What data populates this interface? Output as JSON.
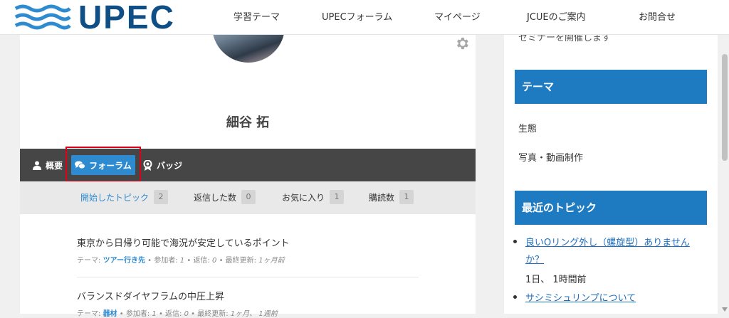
{
  "header": {
    "logo_text": "UPEC",
    "nav": [
      {
        "label": "学習テーマ"
      },
      {
        "label": "UPECフォーラム"
      },
      {
        "label": "マイページ"
      },
      {
        "label": "JCUEのご案内"
      },
      {
        "label": "お問合せ"
      }
    ]
  },
  "profile": {
    "name": "細谷 拓"
  },
  "tabs": {
    "overview": "概要",
    "forum": "フォーラム",
    "badges": "バッジ"
  },
  "subnav": [
    {
      "label": "開始したトピック",
      "count": "2"
    },
    {
      "label": "返信した数",
      "count": "0"
    },
    {
      "label": "お気に入り",
      "count": "1"
    },
    {
      "label": "購読数",
      "count": "1"
    }
  ],
  "topics": [
    {
      "title": "東京から日帰り可能で海況が安定しているポイント",
      "theme_label": "テーマ: ",
      "theme": "ツアー行き先",
      "participants_label": "参加者: ",
      "participants": "1",
      "replies_label": "返信: ",
      "replies": "0",
      "updated_label": "最終更新: ",
      "updated": "1ヶ月前"
    },
    {
      "title": "バランスドダイヤフラムの中圧上昇",
      "theme_label": "テーマ: ",
      "theme": "器材",
      "participants_label": "参加者: ",
      "participants": "1",
      "replies_label": "返信: ",
      "replies": "0",
      "updated_label": "最終更新: ",
      "updated": "1ヶ月、 1週前"
    }
  ],
  "sidebar": {
    "prev_text": "セミナーを開催します",
    "theme_heading": "テーマ",
    "themes": [
      "生態",
      "写真・動画制作"
    ],
    "recent_heading": "最近のトピック",
    "recent": [
      {
        "title": "良いOリング外し（螺旋型）ありませんか？",
        "time": "1日、 1時間前"
      },
      {
        "title": "サシミシュリンプについて",
        "time": ""
      }
    ]
  },
  "colors": {
    "brand_blue": "#0f4f86",
    "accent_blue": "#2f8bd0",
    "sidebar_heading": "#1e7bc2",
    "tabbar": "#464646",
    "highlight_red": "#e0001b"
  }
}
